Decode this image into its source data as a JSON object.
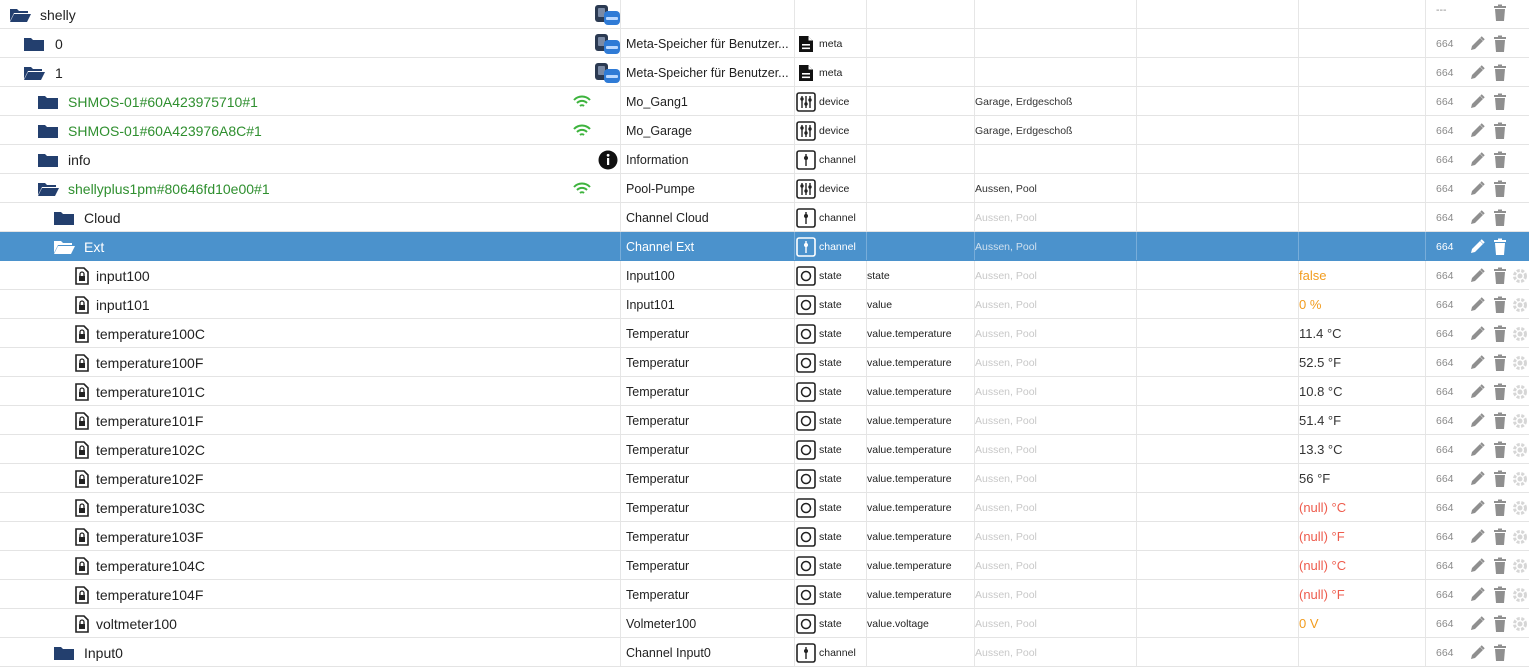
{
  "tree": {
    "selected_id": "Ext",
    "rows": [
      {
        "name": "shelly",
        "depth": 0,
        "kind": "folder-open",
        "title": "",
        "type": "",
        "role": "",
        "room": "",
        "value": "",
        "acl": "---",
        "adapter_icon": true,
        "name_color": "normal",
        "actions": [
          "delete"
        ]
      },
      {
        "name": "0",
        "depth": 1,
        "kind": "folder",
        "title": "Meta-Speicher für Benutzer...",
        "type": "meta",
        "type_icon": "meta-file-icon",
        "role": "",
        "room": "",
        "value": "",
        "acl": "664",
        "adapter_icon": true,
        "name_color": "normal",
        "actions": [
          "edit",
          "delete"
        ]
      },
      {
        "name": "1",
        "depth": 1,
        "kind": "folder-open",
        "title": "Meta-Speicher für Benutzer...",
        "type": "meta",
        "type_icon": "meta-file-icon",
        "role": "",
        "room": "",
        "value": "",
        "acl": "664",
        "adapter_icon": true,
        "name_color": "normal",
        "actions": [
          "edit",
          "delete"
        ]
      },
      {
        "name": "SHMOS-01#60A423975710#1",
        "depth": 2,
        "kind": "folder",
        "title": "Mo_Gang1",
        "type": "device",
        "type_icon": "device-icon",
        "role": "",
        "room": "Garage, Erdgeschoß",
        "room_faint": false,
        "value": "",
        "acl": "664",
        "wifi": true,
        "name_color": "green",
        "actions": [
          "edit",
          "delete"
        ]
      },
      {
        "name": "SHMOS-01#60A423976A8C#1",
        "depth": 2,
        "kind": "folder",
        "title": "Mo_Garage",
        "type": "device",
        "type_icon": "device-icon",
        "role": "",
        "room": "Garage, Erdgeschoß",
        "room_faint": false,
        "value": "",
        "acl": "664",
        "wifi": true,
        "name_color": "green",
        "actions": [
          "edit",
          "delete"
        ]
      },
      {
        "name": "info",
        "depth": 2,
        "kind": "folder",
        "title": "Information",
        "type": "channel",
        "type_icon": "channel-icon",
        "role": "",
        "room": "",
        "value": "",
        "acl": "664",
        "info_icon": true,
        "name_color": "normal",
        "actions": [
          "edit",
          "delete"
        ]
      },
      {
        "name": "shellyplus1pm#80646fd10e00#1",
        "depth": 2,
        "kind": "folder-open",
        "title": "Pool-Pumpe",
        "type": "device",
        "type_icon": "device-icon",
        "role": "",
        "room": "Aussen, Pool",
        "room_faint": false,
        "value": "",
        "acl": "664",
        "wifi": true,
        "name_color": "green",
        "actions": [
          "edit",
          "delete"
        ]
      },
      {
        "name": "Cloud",
        "depth": 3,
        "kind": "folder",
        "title": "Channel Cloud",
        "type": "channel",
        "type_icon": "channel-icon",
        "role": "",
        "room": "Aussen, Pool",
        "room_faint": true,
        "value": "",
        "acl": "664",
        "name_color": "normal",
        "actions": [
          "edit",
          "delete"
        ]
      },
      {
        "name": "Ext",
        "depth": 3,
        "kind": "folder-open",
        "title": "Channel Ext",
        "type": "channel",
        "type_icon": "channel-icon",
        "role": "",
        "room": "Aussen, Pool",
        "room_faint": true,
        "value": "",
        "acl": "664",
        "selected": true,
        "name_color": "normal",
        "actions": [
          "edit",
          "delete"
        ]
      },
      {
        "name": "input100",
        "depth": 4,
        "kind": "state",
        "title": "Input100",
        "type": "state",
        "type_icon": "state-icon",
        "role": "state",
        "room": "Aussen, Pool",
        "room_faint": true,
        "value": "false",
        "value_style": "orange",
        "acl": "664",
        "name_color": "normal",
        "actions": [
          "edit",
          "delete",
          "config"
        ]
      },
      {
        "name": "input101",
        "depth": 4,
        "kind": "state",
        "title": "Input101",
        "type": "state",
        "type_icon": "state-icon",
        "role": "value",
        "room": "Aussen, Pool",
        "room_faint": true,
        "value": "0 %",
        "value_style": "orange",
        "acl": "664",
        "name_color": "normal",
        "actions": [
          "edit",
          "delete",
          "config"
        ]
      },
      {
        "name": "temperature100C",
        "depth": 4,
        "kind": "state",
        "title": "Temperatur",
        "type": "state",
        "type_icon": "state-icon",
        "role": "value.temperature",
        "room": "Aussen, Pool",
        "room_faint": true,
        "value": "11.4 °C",
        "value_style": "dark",
        "acl": "664",
        "name_color": "normal",
        "actions": [
          "edit",
          "delete",
          "config"
        ]
      },
      {
        "name": "temperature100F",
        "depth": 4,
        "kind": "state",
        "title": "Temperatur",
        "type": "state",
        "type_icon": "state-icon",
        "role": "value.temperature",
        "room": "Aussen, Pool",
        "room_faint": true,
        "value": "52.5 °F",
        "value_style": "dark",
        "acl": "664",
        "name_color": "normal",
        "actions": [
          "edit",
          "delete",
          "config"
        ]
      },
      {
        "name": "temperature101C",
        "depth": 4,
        "kind": "state",
        "title": "Temperatur",
        "type": "state",
        "type_icon": "state-icon",
        "role": "value.temperature",
        "room": "Aussen, Pool",
        "room_faint": true,
        "value": "10.8 °C",
        "value_style": "dark",
        "acl": "664",
        "name_color": "normal",
        "actions": [
          "edit",
          "delete",
          "config"
        ]
      },
      {
        "name": "temperature101F",
        "depth": 4,
        "kind": "state",
        "title": "Temperatur",
        "type": "state",
        "type_icon": "state-icon",
        "role": "value.temperature",
        "room": "Aussen, Pool",
        "room_faint": true,
        "value": "51.4 °F",
        "value_style": "dark",
        "acl": "664",
        "name_color": "normal",
        "actions": [
          "edit",
          "delete",
          "config"
        ]
      },
      {
        "name": "temperature102C",
        "depth": 4,
        "kind": "state",
        "title": "Temperatur",
        "type": "state",
        "type_icon": "state-icon",
        "role": "value.temperature",
        "room": "Aussen, Pool",
        "room_faint": true,
        "value": "13.3 °C",
        "value_style": "dark",
        "acl": "664",
        "name_color": "normal",
        "actions": [
          "edit",
          "delete",
          "config"
        ]
      },
      {
        "name": "temperature102F",
        "depth": 4,
        "kind": "state",
        "title": "Temperatur",
        "type": "state",
        "type_icon": "state-icon",
        "role": "value.temperature",
        "room": "Aussen, Pool",
        "room_faint": true,
        "value": "56 °F",
        "value_style": "dark",
        "acl": "664",
        "name_color": "normal",
        "actions": [
          "edit",
          "delete",
          "config"
        ]
      },
      {
        "name": "temperature103C",
        "depth": 4,
        "kind": "state",
        "title": "Temperatur",
        "type": "state",
        "type_icon": "state-icon",
        "role": "value.temperature",
        "room": "Aussen, Pool",
        "room_faint": true,
        "value": "(null) °C",
        "value_style": "red",
        "acl": "664",
        "name_color": "normal",
        "actions": [
          "edit",
          "delete",
          "config"
        ]
      },
      {
        "name": "temperature103F",
        "depth": 4,
        "kind": "state",
        "title": "Temperatur",
        "type": "state",
        "type_icon": "state-icon",
        "role": "value.temperature",
        "room": "Aussen, Pool",
        "room_faint": true,
        "value": "(null) °F",
        "value_style": "red",
        "acl": "664",
        "name_color": "normal",
        "actions": [
          "edit",
          "delete",
          "config"
        ]
      },
      {
        "name": "temperature104C",
        "depth": 4,
        "kind": "state",
        "title": "Temperatur",
        "type": "state",
        "type_icon": "state-icon",
        "role": "value.temperature",
        "room": "Aussen, Pool",
        "room_faint": true,
        "value": "(null) °C",
        "value_style": "red",
        "acl": "664",
        "name_color": "normal",
        "actions": [
          "edit",
          "delete",
          "config"
        ]
      },
      {
        "name": "temperature104F",
        "depth": 4,
        "kind": "state",
        "title": "Temperatur",
        "type": "state",
        "type_icon": "state-icon",
        "role": "value.temperature",
        "room": "Aussen, Pool",
        "room_faint": true,
        "value": "(null) °F",
        "value_style": "red",
        "acl": "664",
        "name_color": "normal",
        "actions": [
          "edit",
          "delete",
          "config"
        ]
      },
      {
        "name": "voltmeter100",
        "depth": 4,
        "kind": "state",
        "title": "Volmeter100",
        "type": "state",
        "type_icon": "state-icon",
        "role": "value.voltage",
        "room": "Aussen, Pool",
        "room_faint": true,
        "value": "0 V",
        "value_style": "orange",
        "acl": "664",
        "name_color": "normal",
        "actions": [
          "edit",
          "delete",
          "config"
        ]
      },
      {
        "name": "Input0",
        "depth": 3,
        "kind": "folder",
        "title": "Channel Input0",
        "type": "channel",
        "type_icon": "channel-icon",
        "role": "",
        "room": "Aussen, Pool",
        "room_faint": true,
        "value": "",
        "acl": "664",
        "name_color": "normal",
        "actions": [
          "edit",
          "delete"
        ]
      }
    ]
  },
  "colors": {
    "folder": "#233f6e",
    "selected_bg": "#4b92cc",
    "green_name": "#2f8f2f",
    "value_orange": "#f29c1e",
    "value_red": "#ee5b4c",
    "icon_gray": "#8f8f8f"
  }
}
